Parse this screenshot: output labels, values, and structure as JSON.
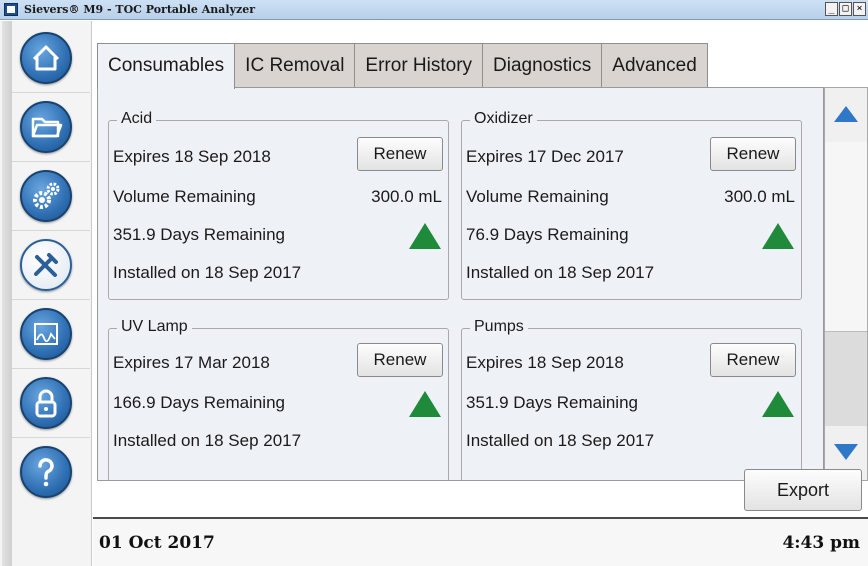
{
  "window": {
    "title": "Sievers® M9 - TOC Portable Analyzer",
    "controls": [
      "_",
      "□",
      "×"
    ]
  },
  "sidebar": {
    "items": [
      {
        "name": "home",
        "icon": "home-icon"
      },
      {
        "name": "data",
        "icon": "folder-icon"
      },
      {
        "name": "setup",
        "icon": "gears-icon"
      },
      {
        "name": "maintenance",
        "icon": "tools-icon"
      },
      {
        "name": "reports",
        "icon": "chart-icon"
      },
      {
        "name": "security",
        "icon": "lock-icon"
      },
      {
        "name": "help",
        "icon": "help-icon"
      }
    ]
  },
  "tabs": [
    {
      "label": "Consumables",
      "active": true
    },
    {
      "label": "IC Removal",
      "active": false
    },
    {
      "label": "Error History",
      "active": false
    },
    {
      "label": "Diagnostics",
      "active": false
    },
    {
      "label": "Advanced",
      "active": false
    }
  ],
  "groups": {
    "acid": {
      "title": "Acid",
      "expires": "Expires 18 Sep 2018",
      "renew_label": "Renew",
      "volume_label": "Volume Remaining",
      "volume_value": "300.0 mL",
      "days": "351.9 Days Remaining",
      "installed": "Installed on 18 Sep 2017",
      "status": "ok"
    },
    "oxidizer": {
      "title": "Oxidizer",
      "expires": "Expires 17 Dec 2017",
      "renew_label": "Renew",
      "volume_label": "Volume Remaining",
      "volume_value": "300.0 mL",
      "days": "76.9 Days Remaining",
      "installed": "Installed on 18 Sep 2017",
      "status": "ok"
    },
    "uv_lamp": {
      "title": "UV Lamp",
      "expires": "Expires 17 Mar 2018",
      "renew_label": "Renew",
      "days": "166.9 Days Remaining",
      "installed": "Installed on 18 Sep 2017",
      "status": "ok"
    },
    "pumps": {
      "title": "Pumps",
      "expires": "Expires 18 Sep 2018",
      "renew_label": "Renew",
      "days": "351.9 Days Remaining",
      "installed": "Installed on 18 Sep 2017",
      "status": "ok"
    }
  },
  "actions": {
    "export_label": "Export"
  },
  "status_bar": {
    "date": "01 Oct 2017",
    "time": "4:43 pm"
  },
  "colors": {
    "accent": "#2f77c8",
    "status_ok": "#1f8a3a",
    "panel_bg": "#eef2f6"
  }
}
